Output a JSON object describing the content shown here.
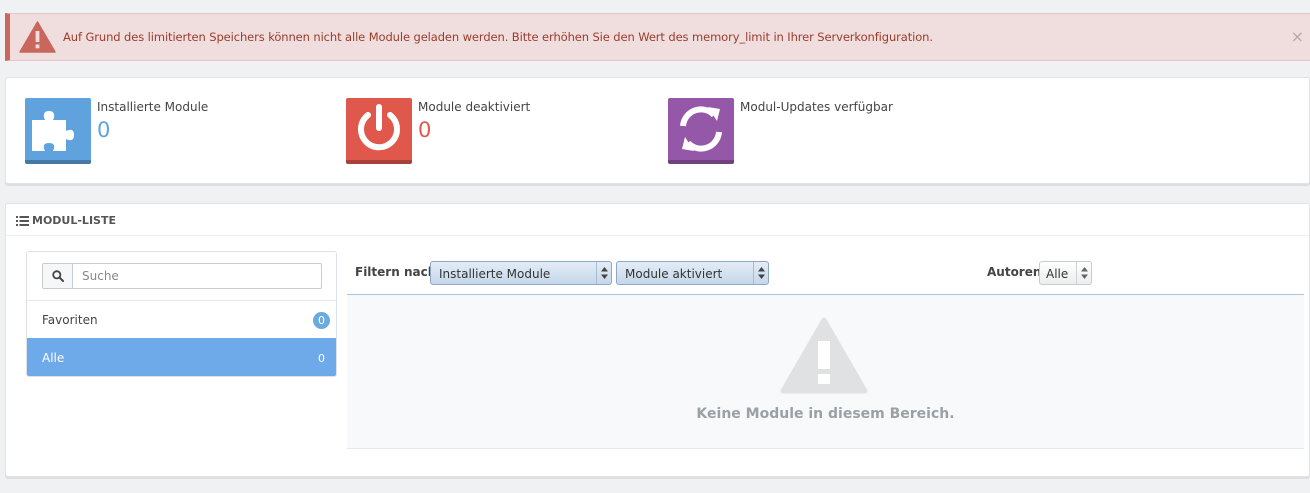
{
  "alert": {
    "message": "Auf Grund des limitierten Speichers können nicht alle Module geladen werden. Bitte erhöhen Sie den Wert des memory_limit in Ihrer Serverkonfiguration.",
    "close_symbol": "×",
    "icon": "warning-triangle-icon",
    "color": "#c9675d"
  },
  "kpis": [
    {
      "label": "Installierte Module",
      "value": "0",
      "icon": "puzzle-icon",
      "color": "#5fa2dd",
      "value_color": "#5fa2dd"
    },
    {
      "label": "Module deaktiviert",
      "value": "0",
      "icon": "power-icon",
      "color": "#e0574c",
      "value_color": "#e0574c"
    },
    {
      "label": "Modul-Updates verfügbar",
      "value": "",
      "icon": "refresh-icon",
      "color": "#9557a8",
      "value_color": "#9557a8"
    }
  ],
  "module_list": {
    "title": "MODUL-LISTE",
    "search": {
      "placeholder": "Suche",
      "value": ""
    },
    "categories": [
      {
        "label": "Favoriten",
        "count": "0"
      },
      {
        "label": "Alle",
        "count": "0",
        "active": true
      }
    ],
    "filter": {
      "label": "Filtern nach",
      "install_select": "Installierte Module",
      "status_select": "Module aktiviert"
    },
    "authors": {
      "label": "Autoren",
      "select": "Alle"
    },
    "empty_message": "Keine Module in diesem Bereich."
  }
}
